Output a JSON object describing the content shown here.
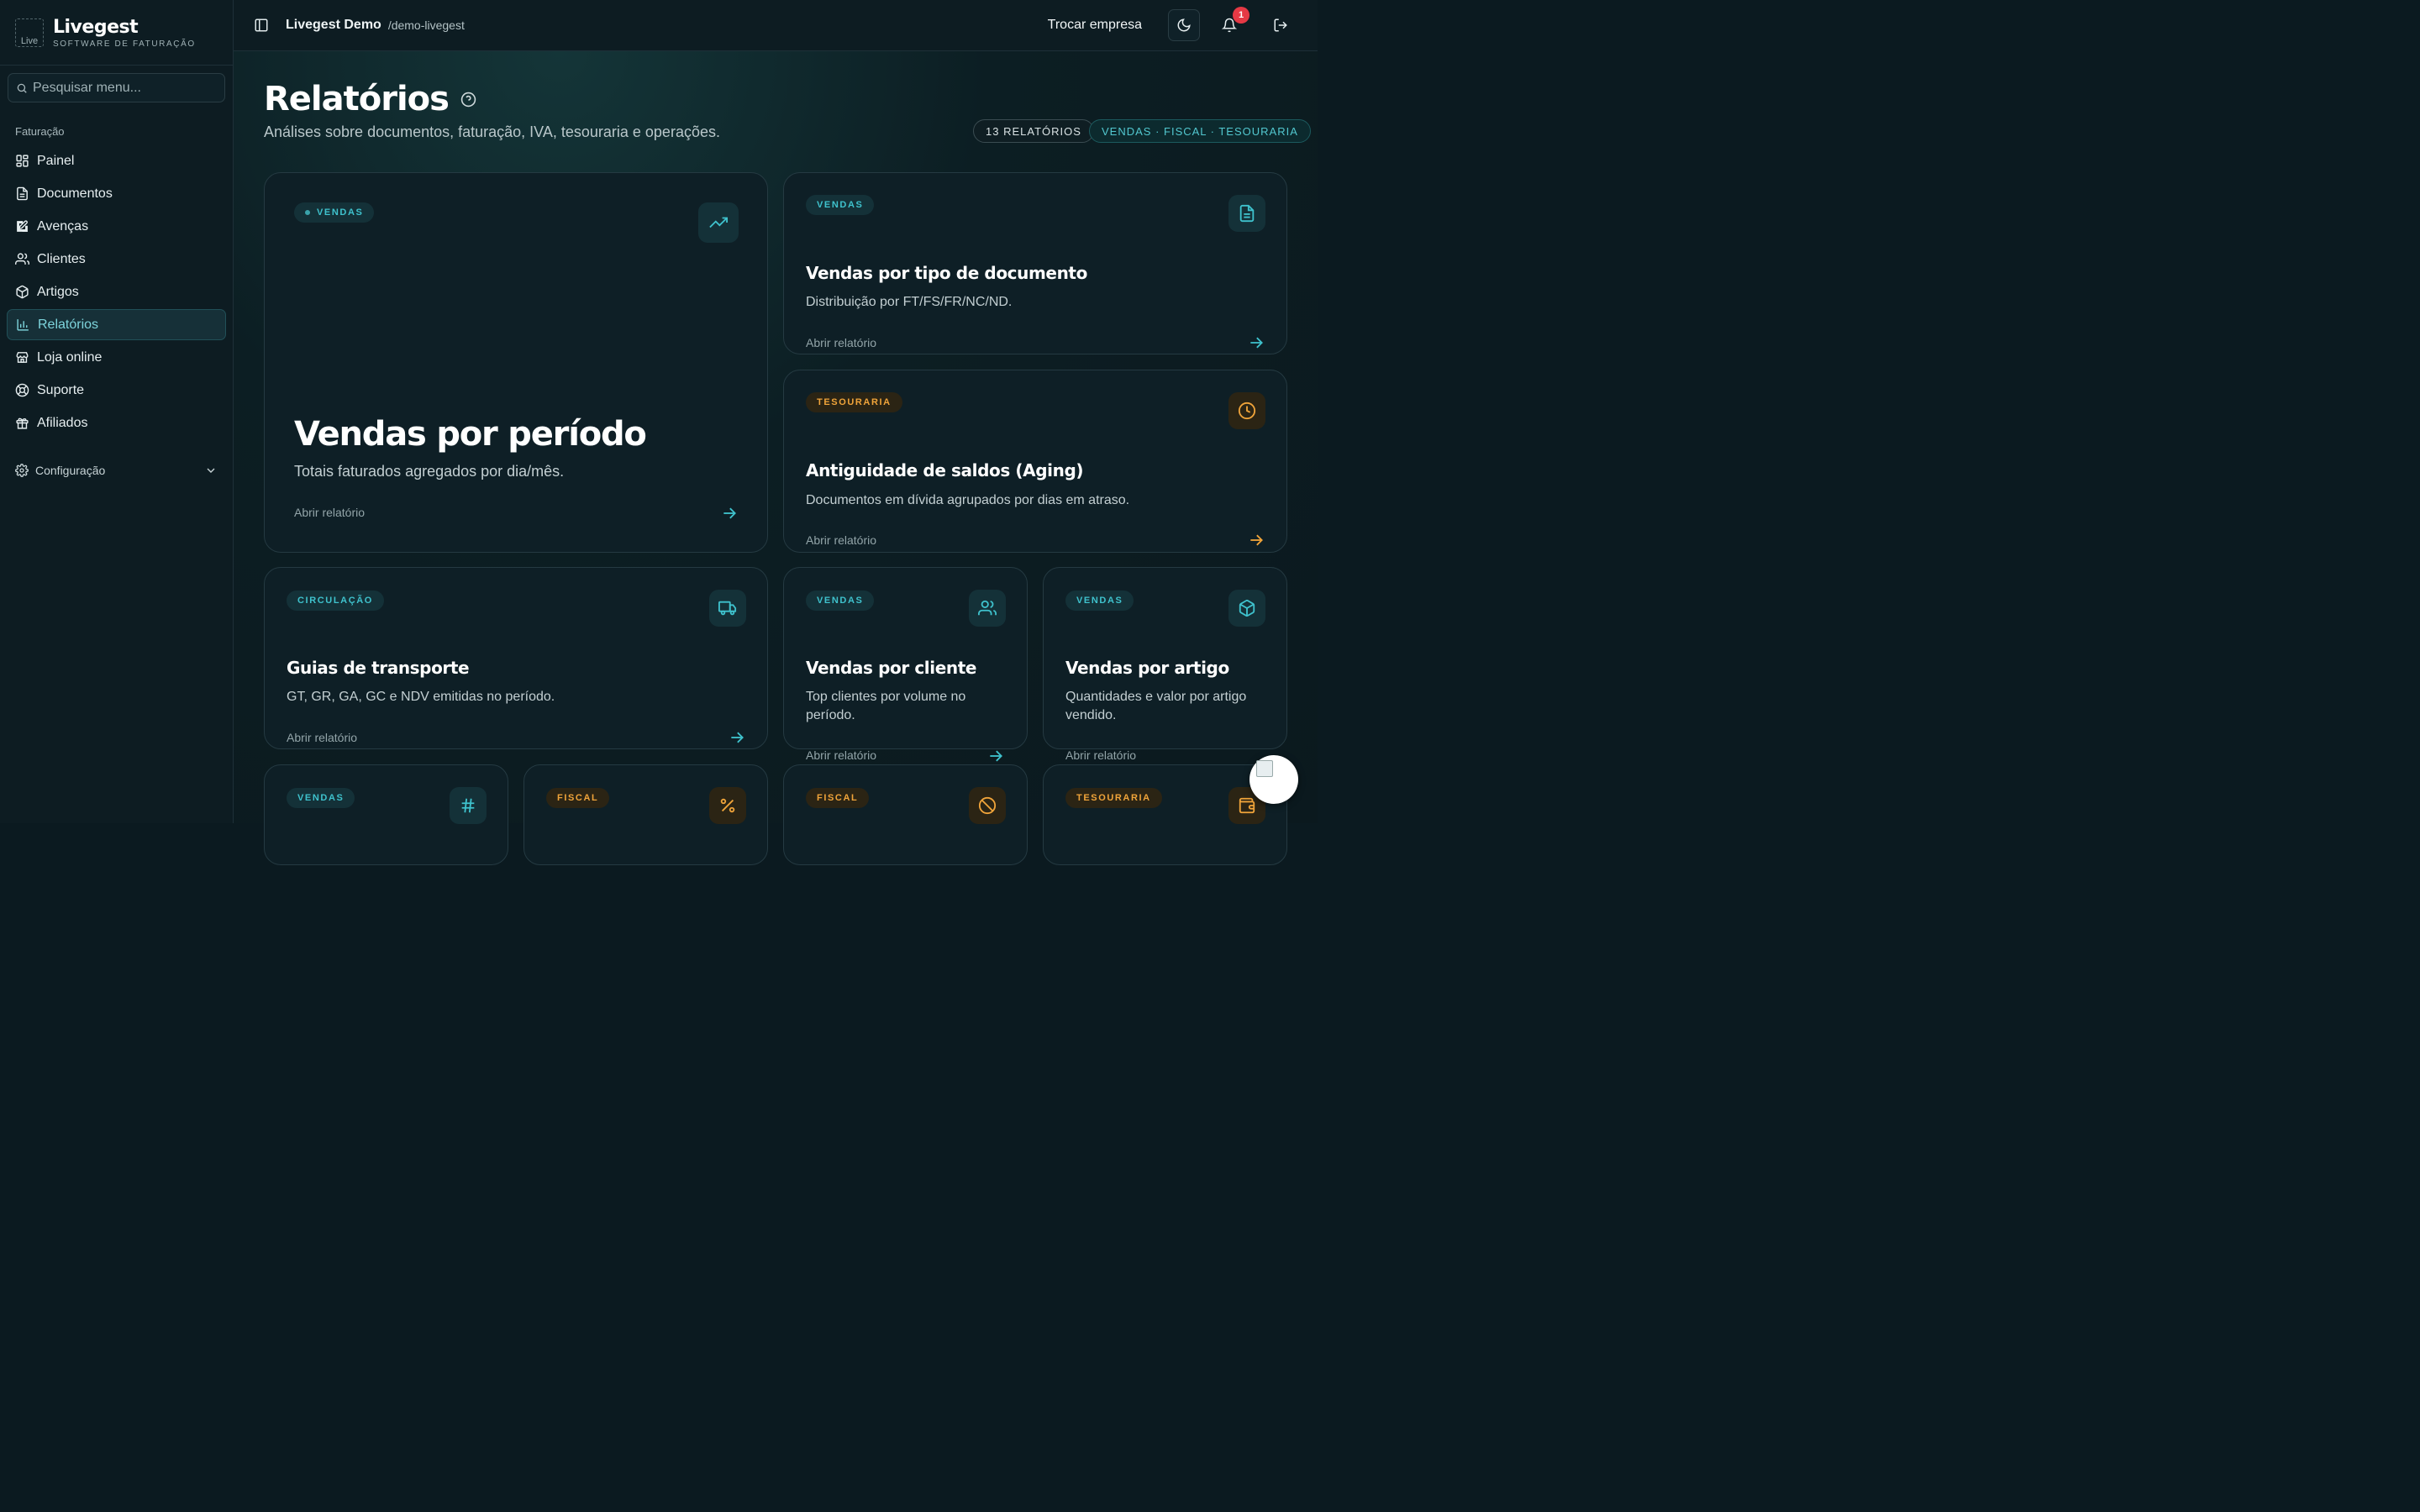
{
  "brand": {
    "name": "Livegest",
    "subtitle": "SOFTWARE DE FATURAÇÃO",
    "logo_alt": "Live"
  },
  "search": {
    "placeholder": "Pesquisar menu..."
  },
  "sidebar": {
    "section": "Faturação",
    "items": [
      {
        "label": "Painel",
        "icon": "dashboard-icon"
      },
      {
        "label": "Documentos",
        "icon": "document-icon"
      },
      {
        "label": "Avenças",
        "icon": "edit-icon"
      },
      {
        "label": "Clientes",
        "icon": "users-icon"
      },
      {
        "label": "Artigos",
        "icon": "box-icon"
      },
      {
        "label": "Relatórios",
        "icon": "chart-icon",
        "active": true
      },
      {
        "label": "Loja online",
        "icon": "store-icon"
      },
      {
        "label": "Suporte",
        "icon": "lifebuoy-icon"
      },
      {
        "label": "Afiliados",
        "icon": "gift-icon"
      }
    ],
    "config": "Configuração"
  },
  "topbar": {
    "company": "Livegest Demo",
    "slug": "/demo-livegest",
    "switch_label": "Trocar empresa",
    "notifications": "1"
  },
  "page": {
    "title": "Relatórios",
    "subtitle": "Análises sobre documentos, faturação, IVA, tesouraria e operações.",
    "count_pill": "13 RELATÓRIOS",
    "categories_pill": "VENDAS · FISCAL · TESOURARIA"
  },
  "open_label": "Abrir relatório",
  "cards": [
    {
      "tag": "VENDAS",
      "title": "Vendas por período",
      "desc": "Totais faturados agregados por dia/mês.",
      "icon": "trend-up-icon"
    },
    {
      "tag": "VENDAS",
      "title": "Vendas por tipo de documento",
      "desc": "Distribuição por FT/FS/FR/NC/ND.",
      "icon": "file-text-icon"
    },
    {
      "tag": "TESOURARIA",
      "title": "Antiguidade de saldos (Aging)",
      "desc": "Documentos em dívida agrupados por dias em atraso.",
      "icon": "clock-icon"
    },
    {
      "tag": "CIRCULAÇÃO",
      "title": "Guias de transporte",
      "desc": "GT, GR, GA, GC e NDV emitidas no período.",
      "icon": "truck-icon"
    },
    {
      "tag": "VENDAS",
      "title": "Vendas por cliente",
      "desc": "Top clientes por volume no período.",
      "icon": "users-icon"
    },
    {
      "tag": "VENDAS",
      "title": "Vendas por artigo",
      "desc": "Quantidades e valor por artigo vendido.",
      "icon": "box-icon"
    },
    {
      "tag": "VENDAS",
      "icon": "hash-icon"
    },
    {
      "tag": "FISCAL",
      "icon": "percent-icon"
    },
    {
      "tag": "FISCAL",
      "icon": "ban-icon"
    },
    {
      "tag": "TESOURARIA",
      "icon": "wallet-icon"
    }
  ],
  "colors": {
    "accent_teal": "#3fc2cd",
    "accent_amber": "#f0a43a",
    "badge_red": "#e53945"
  }
}
